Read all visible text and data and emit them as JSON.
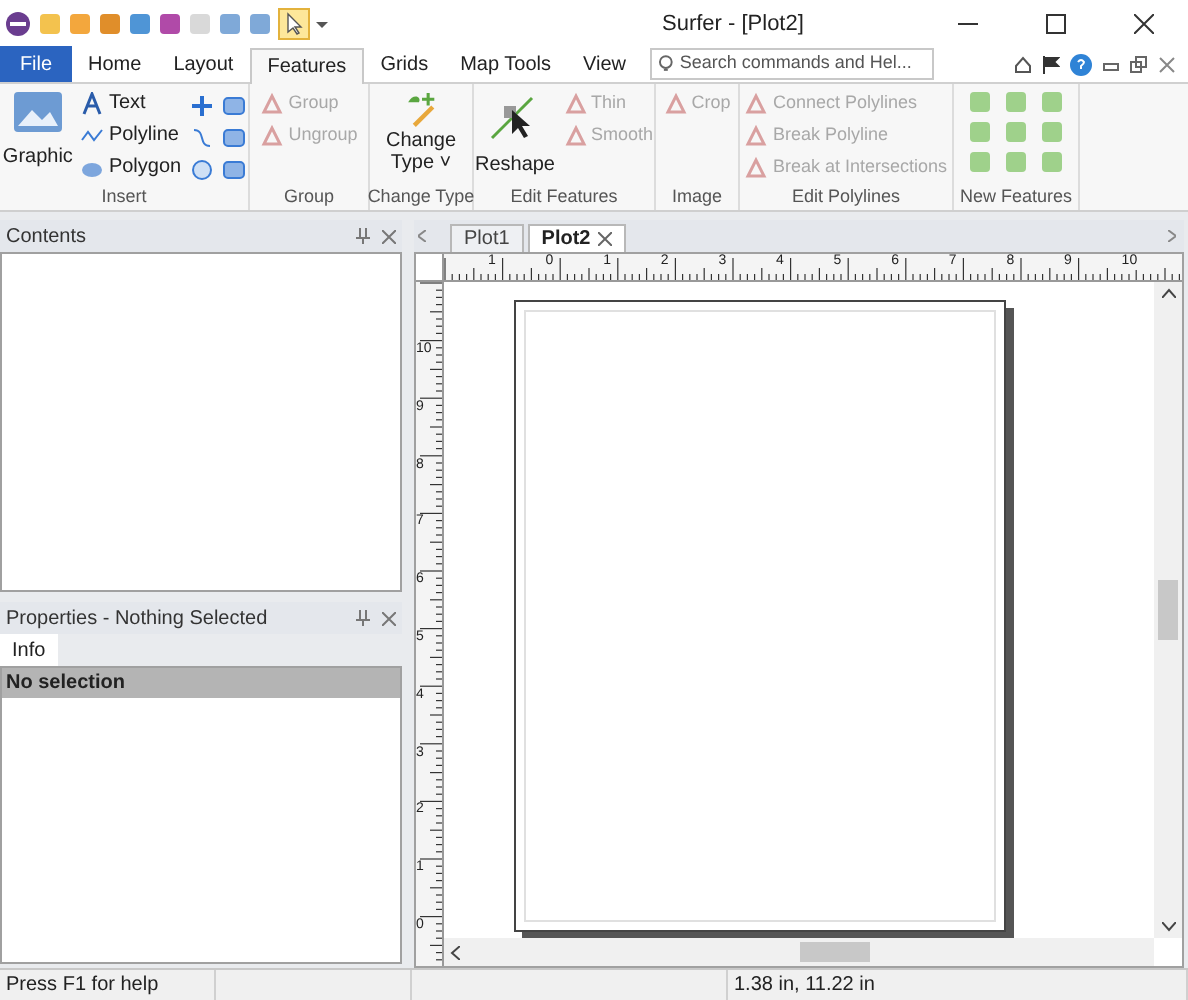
{
  "window": {
    "title": "Surfer - [Plot2]"
  },
  "tabs": [
    {
      "label": "File",
      "kind": "file",
      "selected": false
    },
    {
      "label": "Home",
      "kind": "tab",
      "selected": false
    },
    {
      "label": "Layout",
      "kind": "tab",
      "selected": false
    },
    {
      "label": "Features",
      "kind": "tab",
      "selected": true
    },
    {
      "label": "Grids",
      "kind": "tab",
      "selected": false
    },
    {
      "label": "Map Tools",
      "kind": "tab",
      "selected": false
    },
    {
      "label": "View",
      "kind": "tab",
      "selected": false
    }
  ],
  "search": {
    "placeholder": "Search commands and Hel..."
  },
  "ribbon": [
    {
      "name": "Insert",
      "kind": "insert",
      "items": [
        {
          "label": "Graphic",
          "disabled": false
        },
        {
          "label": "Text",
          "disabled": false
        },
        {
          "label": "Polyline",
          "disabled": false
        },
        {
          "label": "Polygon",
          "disabled": false
        }
      ]
    },
    {
      "name": "Group",
      "kind": "list",
      "items": [
        {
          "label": "Group",
          "disabled": true
        },
        {
          "label": "Ungroup",
          "disabled": true
        }
      ]
    },
    {
      "name": "Change Type",
      "kind": "large",
      "items": [
        {
          "label": "Change Type ˅",
          "disabled": false
        }
      ]
    },
    {
      "name": "Edit Features",
      "kind": "mixed",
      "items": [
        {
          "label": "Reshape",
          "disabled": false
        },
        {
          "label": "Thin",
          "disabled": true
        },
        {
          "label": "Smooth",
          "disabled": true
        }
      ]
    },
    {
      "name": "Image",
      "kind": "list",
      "items": [
        {
          "label": "Crop",
          "disabled": true
        }
      ]
    },
    {
      "name": "Edit Polylines",
      "kind": "list",
      "items": [
        {
          "label": "Connect Polylines",
          "disabled": true
        },
        {
          "label": "Break Polyline",
          "disabled": true
        },
        {
          "label": "Break at Intersections",
          "disabled": true
        }
      ]
    },
    {
      "name": "New Features",
      "kind": "grid"
    }
  ],
  "contents": {
    "title": "Contents"
  },
  "properties": {
    "title": "Properties - Nothing Selected",
    "tabs": [
      {
        "label": "Info",
        "selected": true
      }
    ],
    "header": "No selection"
  },
  "documents": [
    {
      "label": "Plot1",
      "selected": false
    },
    {
      "label": "Plot2",
      "selected": true
    }
  ],
  "rulers": {
    "horizontal": [
      "1",
      "0",
      "1",
      "2",
      "3",
      "4",
      "5",
      "6",
      "7",
      "8",
      "9",
      "10"
    ],
    "vertical": [
      "10",
      "9",
      "8",
      "7",
      "6",
      "5",
      "4",
      "3",
      "2",
      "1",
      "0"
    ]
  },
  "status_bar": [
    "Press F1 for help",
    "1.38 in, 11.22 in"
  ]
}
